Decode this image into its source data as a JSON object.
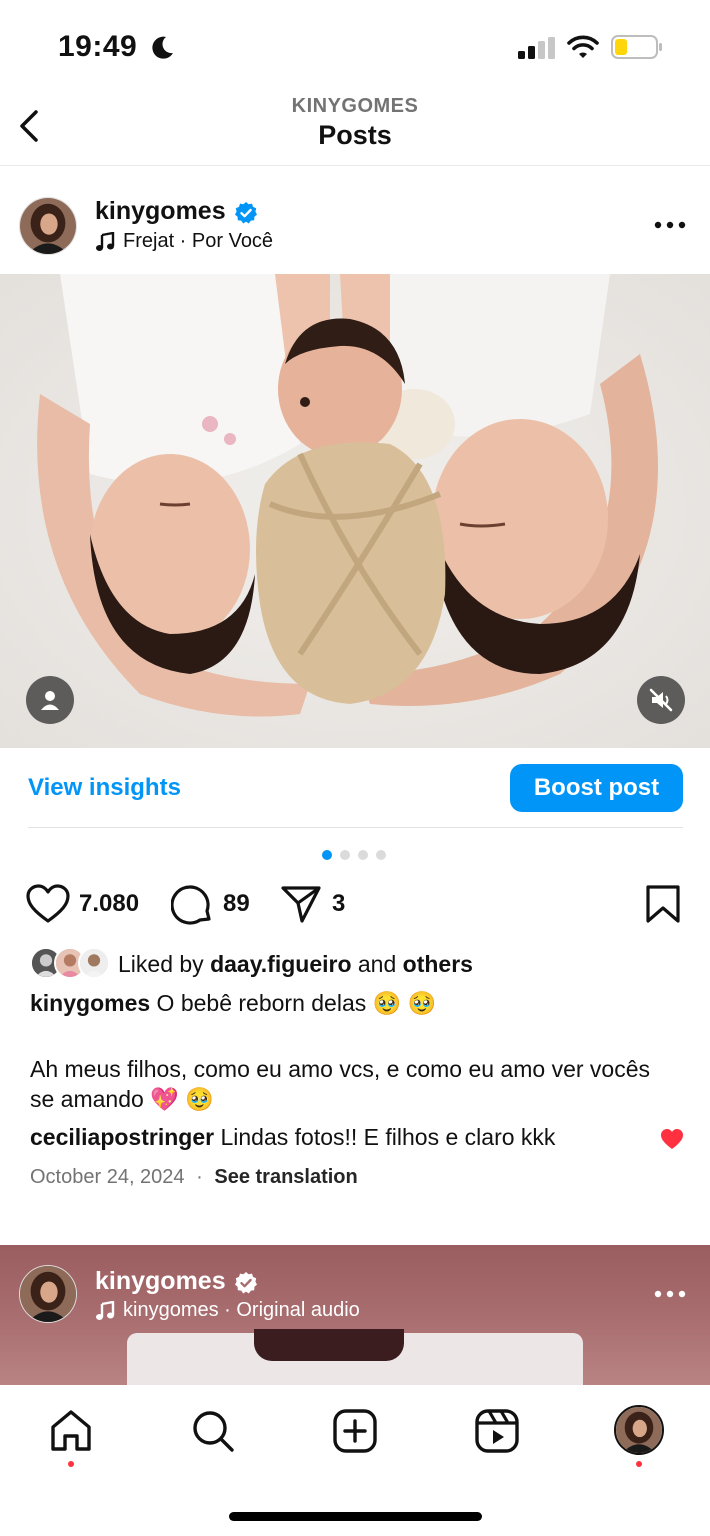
{
  "status_bar": {
    "time": "19:49",
    "battery_color": "#ffd60a"
  },
  "header": {
    "subtitle": "KINYGOMES",
    "title": "Posts"
  },
  "post": {
    "username": "kinygomes",
    "audio": "Frejat · Por Você",
    "insights_label": "View insights",
    "boost_label": "Boost post",
    "carousel": {
      "count": 4,
      "active_index": 0
    },
    "likes": "7.080",
    "comments": "89",
    "shares": "3",
    "liked_by_prefix": "Liked by",
    "liked_by_user": "daay.figueiro",
    "liked_by_and": "and",
    "liked_by_others": "others",
    "caption_user": "kinygomes",
    "caption_line1": "O bebê reborn delas 🥹 🥹",
    "caption_line2": "Ah meus filhos, como eu amo vcs, e como eu amo ver vocês se amando 💖 🥹",
    "comment_user": "ceciliapostringer",
    "comment_text": "Lindas fotos!! E filhos e claro kkk",
    "date": "October 24, 2024",
    "separator": "·",
    "see_translation": "See translation"
  },
  "next_post": {
    "username": "kinygomes",
    "audio": "kinygomes · Original audio"
  },
  "colors": {
    "accent": "#0095f6",
    "like_red": "#ff3040",
    "muted_text": "#737373"
  },
  "icons": [
    "back-icon",
    "verified-icon",
    "music-note-icon",
    "more-icon",
    "user-tag-icon",
    "mute-icon",
    "heart-icon",
    "comment-icon",
    "share-icon",
    "bookmark-icon",
    "home-icon",
    "search-icon",
    "create-icon",
    "reels-icon",
    "profile-avatar"
  ]
}
